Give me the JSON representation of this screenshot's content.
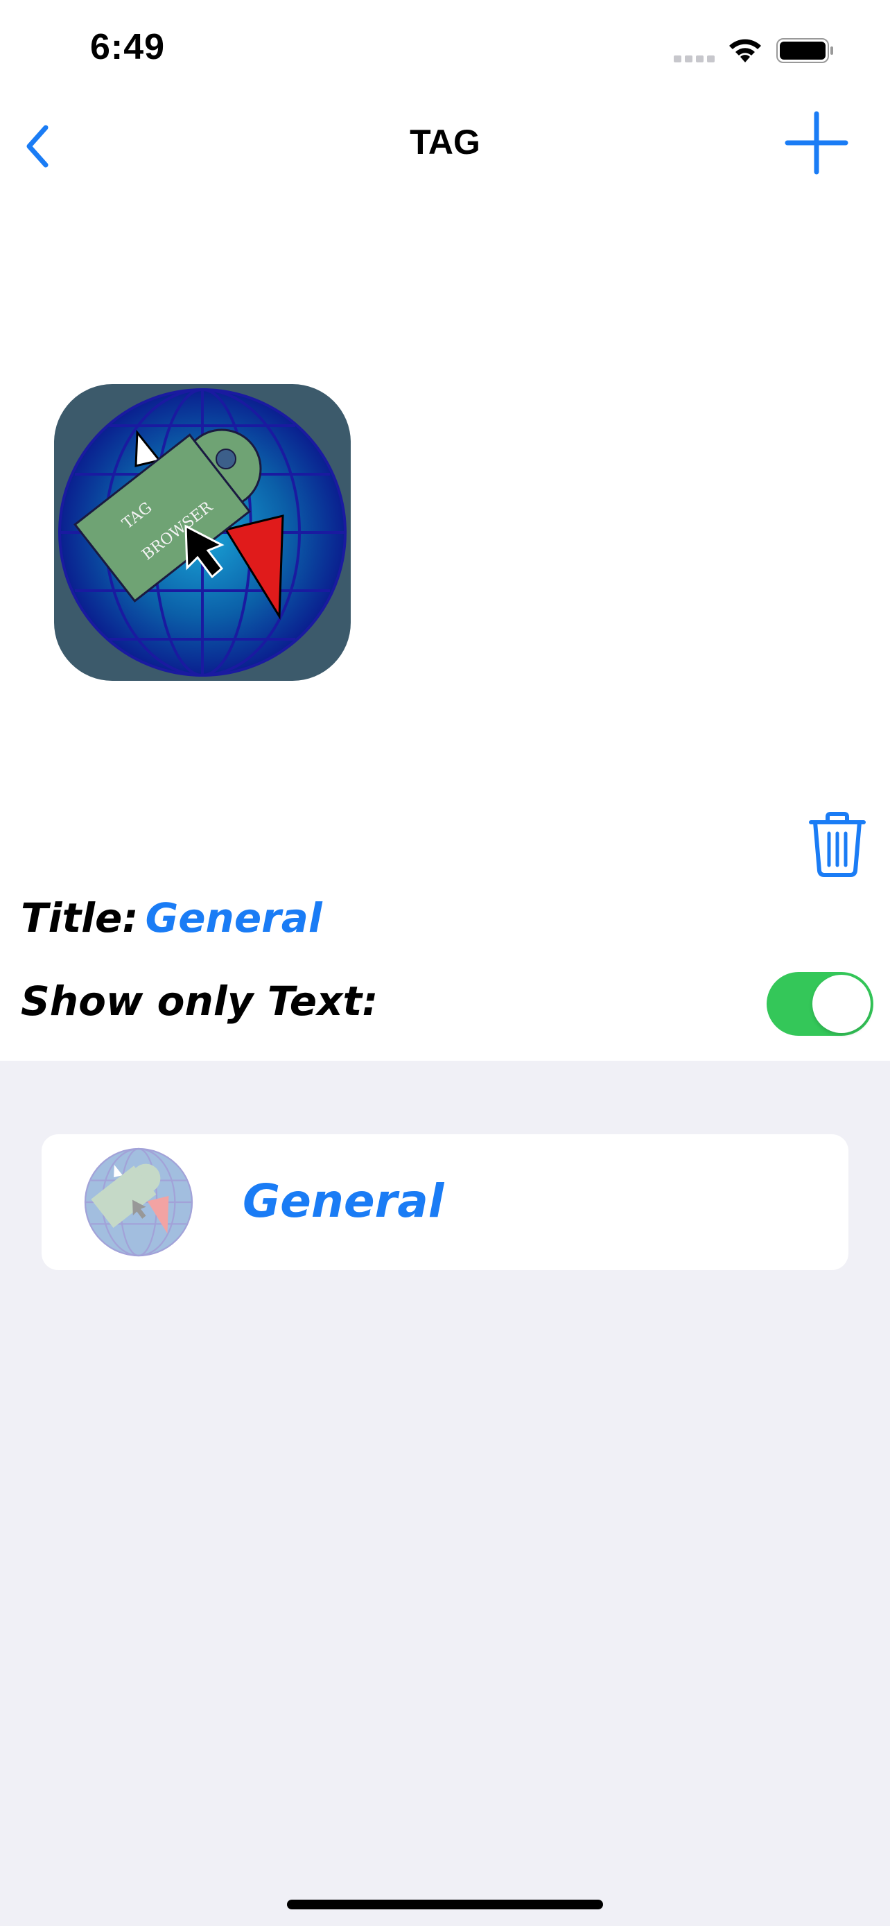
{
  "status_bar": {
    "time": "6:49"
  },
  "nav": {
    "title": "TAG"
  },
  "tag_image": {
    "logo_text_line1": "TAG",
    "logo_text_line2": "BROWSER"
  },
  "form": {
    "title_label": "Title:",
    "title_value": "General",
    "show_only_text_label": "Show only Text:",
    "show_only_text_enabled": true
  },
  "list": {
    "items": [
      {
        "label": "General"
      }
    ]
  },
  "colors": {
    "accent": "#1a7cf5",
    "toggle_on": "#34c759",
    "grouped_background": "#f0f0f6"
  },
  "icons": {
    "back": "chevron-left-icon",
    "add": "plus-icon",
    "delete": "trash-icon"
  }
}
